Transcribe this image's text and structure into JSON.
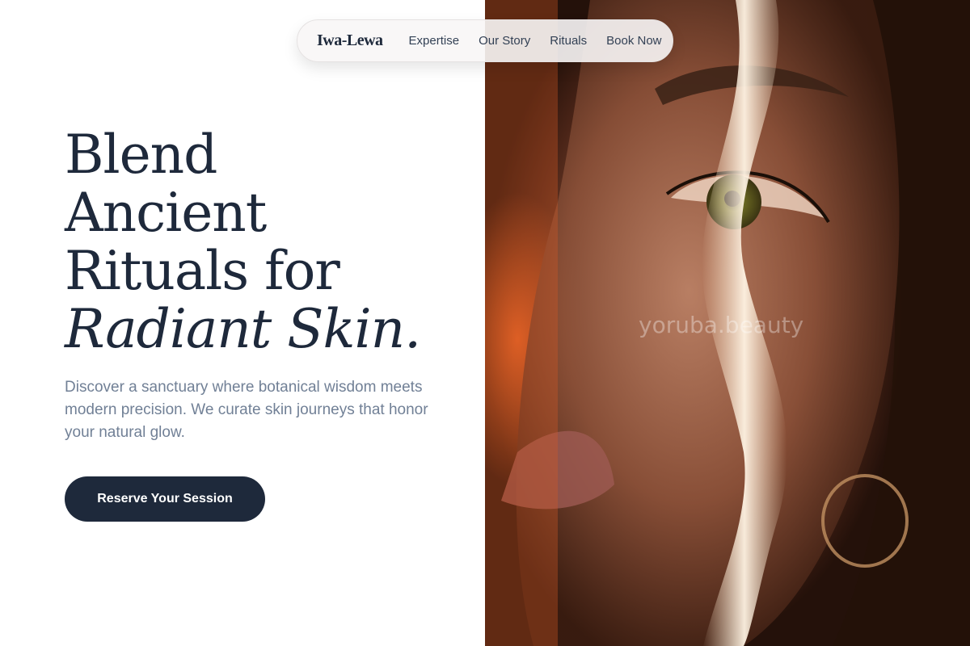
{
  "nav": {
    "logo": "Iwa-Lewa",
    "links": [
      "Expertise",
      "Our Story",
      "Rituals",
      "Book Now"
    ]
  },
  "hero": {
    "headline_lines": [
      "Blend",
      "Ancient",
      "Rituals for"
    ],
    "headline_accent": "Radiant Skin.",
    "lead": "Discover a sanctuary where botanical wisdom meets modern precision. We curate skin journeys that honor your natural glow.",
    "cta_label": "Reserve Your Session"
  },
  "photo": {
    "watermark": "yoruba.beauty"
  },
  "colors": {
    "primary": "#1e293b",
    "muted_text": "#718096",
    "background": "#ffffff"
  }
}
